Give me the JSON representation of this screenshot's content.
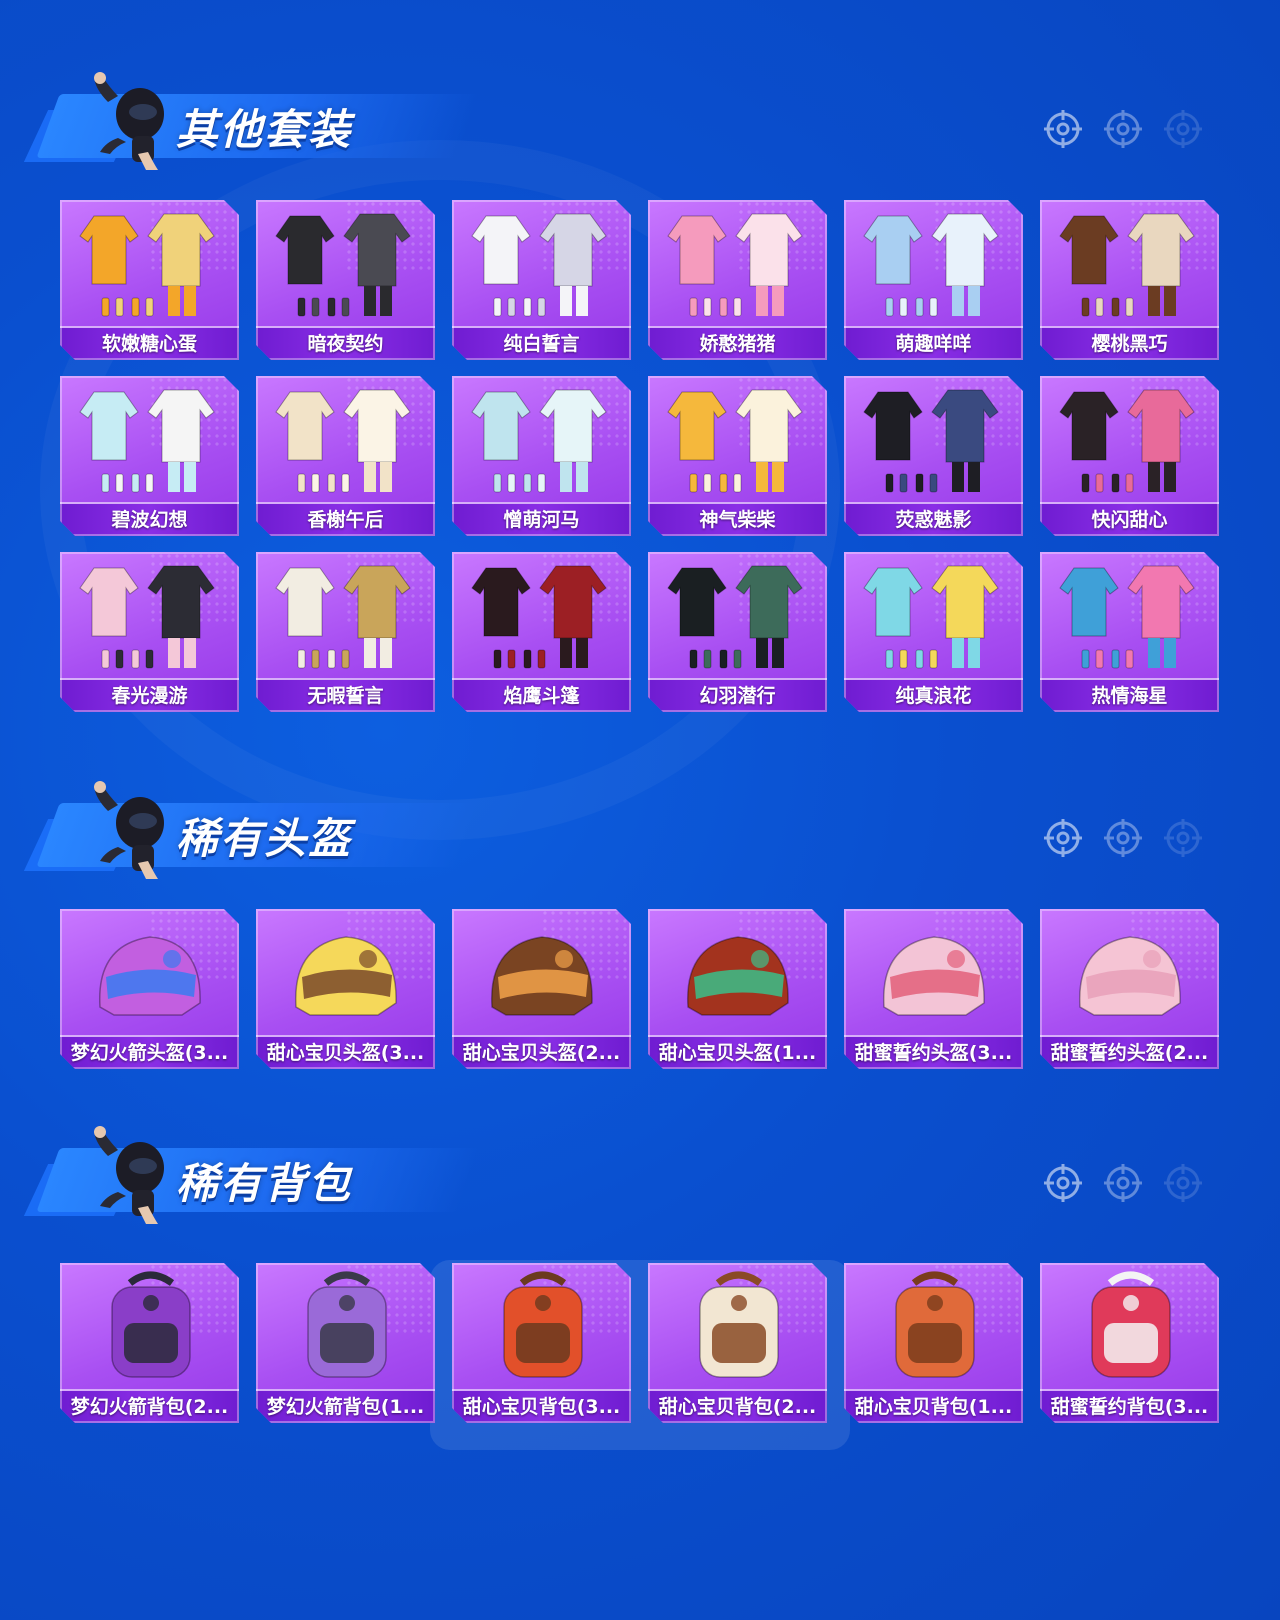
{
  "sections": [
    {
      "title": "其他套装",
      "items": [
        {
          "label": "软嫩糖心蛋",
          "colors": [
            "#f3a629",
            "#f0d27a"
          ]
        },
        {
          "label": "暗夜契约",
          "colors": [
            "#2a2a2e",
            "#4a4a52"
          ]
        },
        {
          "label": "纯白誓言",
          "colors": [
            "#f4f4f8",
            "#d6d6e6"
          ]
        },
        {
          "label": "娇憨猪猪",
          "colors": [
            "#f59bbd",
            "#fbe1ea"
          ]
        },
        {
          "label": "萌趣咩咩",
          "colors": [
            "#a9cff2",
            "#e8f2fb"
          ]
        },
        {
          "label": "樱桃黑巧",
          "colors": [
            "#6b3c22",
            "#e9d7bf"
          ]
        },
        {
          "label": "碧波幻想",
          "colors": [
            "#c6ecf4",
            "#f5f5f5"
          ]
        },
        {
          "label": "香榭午后",
          "colors": [
            "#f2e3c8",
            "#fbf4e6"
          ]
        },
        {
          "label": "憎萌河马",
          "colors": [
            "#bfe4ee",
            "#e6f5f8"
          ]
        },
        {
          "label": "神气柴柴",
          "colors": [
            "#f5b83c",
            "#fbf2dc"
          ]
        },
        {
          "label": "荧惑魅影",
          "colors": [
            "#1e1e24",
            "#3a4a80"
          ]
        },
        {
          "label": "快闪甜心",
          "colors": [
            "#2a2226",
            "#e86a9a"
          ]
        },
        {
          "label": "春光漫游",
          "colors": [
            "#f4c8d8",
            "#2c2c34"
          ]
        },
        {
          "label": "无暇誓言",
          "colors": [
            "#f2ede2",
            "#c9a55a"
          ]
        },
        {
          "label": "焰鹰斗篷",
          "colors": [
            "#2a1a1e",
            "#9c1f24"
          ]
        },
        {
          "label": "幻羽潜行",
          "colors": [
            "#1a1f22",
            "#3d6b5a"
          ]
        },
        {
          "label": "纯真浪花",
          "colors": [
            "#7fd8e6",
            "#f4d85a"
          ]
        },
        {
          "label": "热情海星",
          "colors": [
            "#3fa0d8",
            "#f278b0"
          ]
        }
      ]
    },
    {
      "title": "稀有头盔",
      "items": [
        {
          "label": "梦幻火箭头盔(3...",
          "colors": [
            "#c25fe0",
            "#3a7bf0"
          ]
        },
        {
          "label": "甜心宝贝头盔(3...",
          "colors": [
            "#f5d85a",
            "#7a4a2a"
          ]
        },
        {
          "label": "甜心宝贝头盔(2...",
          "colors": [
            "#7a4422",
            "#f2a24a"
          ]
        },
        {
          "label": "甜心宝贝头盔(1...",
          "colors": [
            "#a3331e",
            "#3ac08a"
          ]
        },
        {
          "label": "甜蜜誓约头盔(3...",
          "colors": [
            "#f3c4d6",
            "#e2607a"
          ]
        },
        {
          "label": "甜蜜誓约头盔(2...",
          "colors": [
            "#f5c4d4",
            "#e8a0b8"
          ]
        }
      ]
    },
    {
      "title": "稀有背包",
      "items": [
        {
          "label": "梦幻火箭背包(2...",
          "colors": [
            "#8a3ec8",
            "#2a2a3a"
          ]
        },
        {
          "label": "梦幻火箭背包(1...",
          "colors": [
            "#9a6ad8",
            "#3a3a4a"
          ]
        },
        {
          "label": "甜心宝贝背包(3...",
          "colors": [
            "#e2502a",
            "#6b3a1e"
          ]
        },
        {
          "label": "甜心宝贝背包(2...",
          "colors": [
            "#f2e6d2",
            "#8a4a26"
          ]
        },
        {
          "label": "甜心宝贝背包(1...",
          "colors": [
            "#e06a3a",
            "#7a3c1c"
          ]
        },
        {
          "label": "甜蜜誓约背包(3...",
          "colors": [
            "#e03a5a",
            "#f4f4f4"
          ]
        }
      ]
    }
  ]
}
